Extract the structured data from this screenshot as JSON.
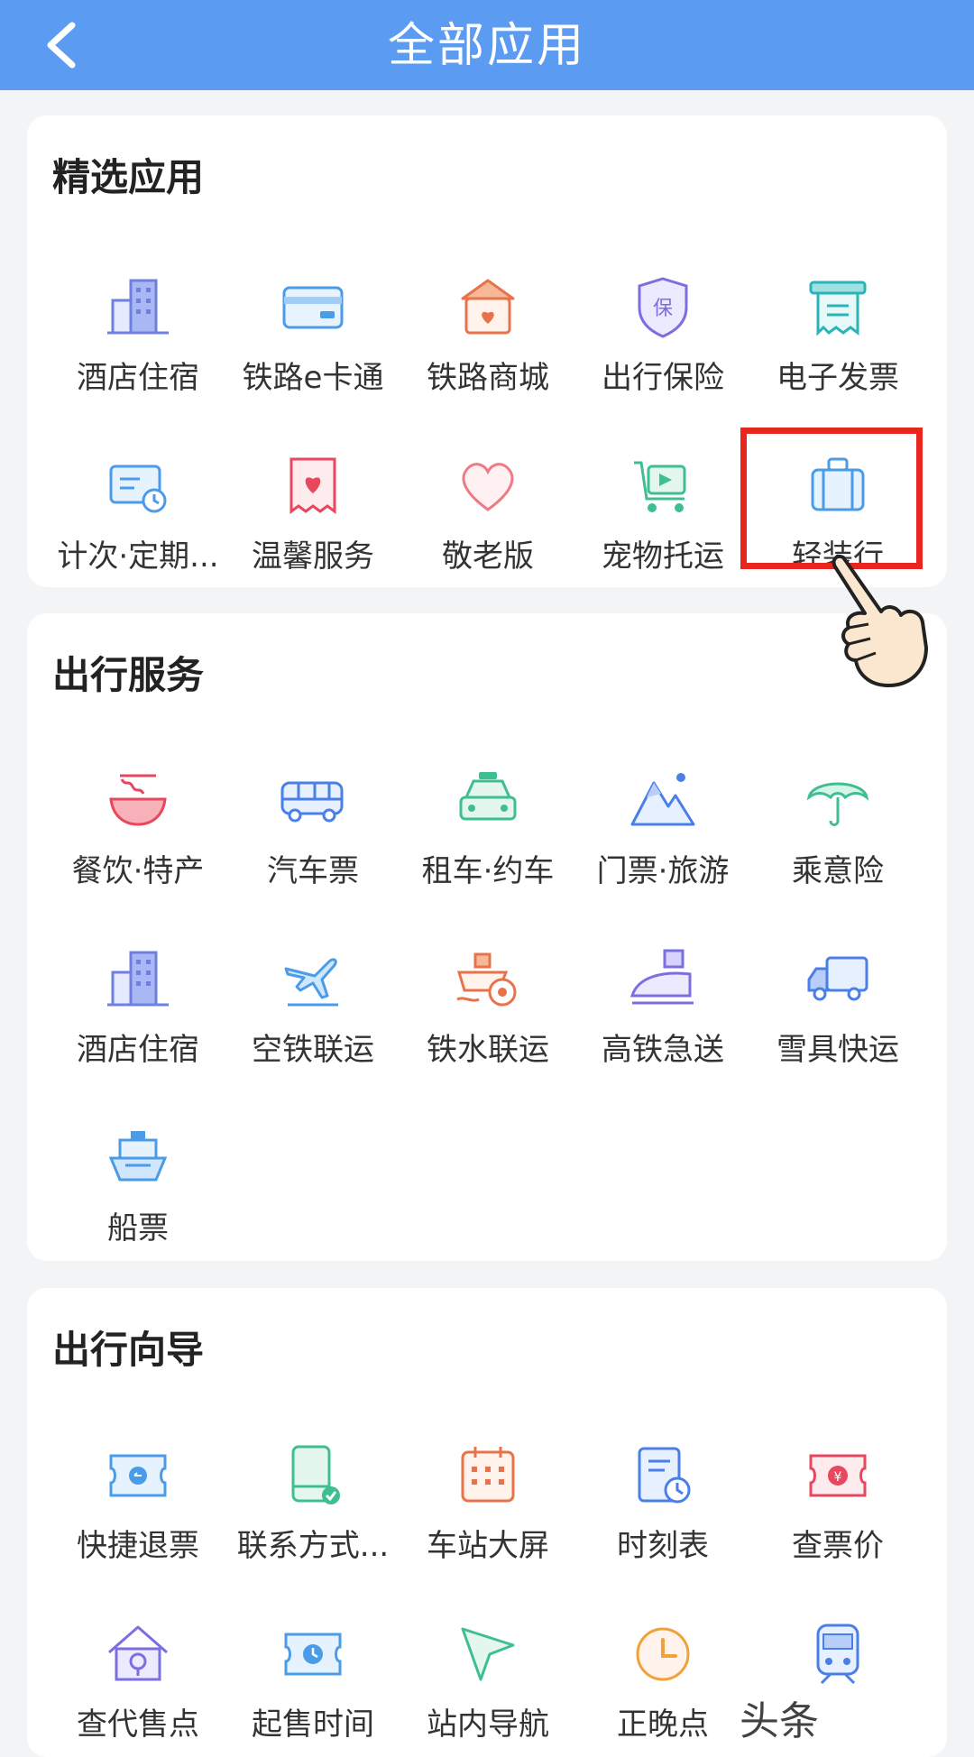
{
  "header": {
    "title": "全部应用"
  },
  "sections": [
    {
      "title": "精选应用",
      "items": [
        {
          "label": "酒店住宿",
          "icon": "hotel-building-icon"
        },
        {
          "label": "铁路e卡通",
          "icon": "card-icon"
        },
        {
          "label": "铁路商城",
          "icon": "shop-icon"
        },
        {
          "label": "出行保险",
          "icon": "insurance-shield-icon"
        },
        {
          "label": "电子发票",
          "icon": "invoice-icon"
        },
        {
          "label": "计次·定期...",
          "icon": "ticket-clock-icon"
        },
        {
          "label": "温馨服务",
          "icon": "heart-card-icon"
        },
        {
          "label": "敬老版",
          "icon": "heart-icon"
        },
        {
          "label": "宠物托运",
          "icon": "pet-cart-icon"
        },
        {
          "label": "轻装行",
          "icon": "luggage-icon"
        }
      ]
    },
    {
      "title": "出行服务",
      "items": [
        {
          "label": "餐饮·特产",
          "icon": "noodle-bowl-icon"
        },
        {
          "label": "汽车票",
          "icon": "bus-icon"
        },
        {
          "label": "租车·约车",
          "icon": "taxi-icon"
        },
        {
          "label": "门票·旅游",
          "icon": "mountain-icon"
        },
        {
          "label": "乘意险",
          "icon": "umbrella-icon"
        },
        {
          "label": "酒店住宿",
          "icon": "hotel-building-icon"
        },
        {
          "label": "空铁联运",
          "icon": "plane-train-icon"
        },
        {
          "label": "铁水联运",
          "icon": "ship-train-icon"
        },
        {
          "label": "高铁急送",
          "icon": "bullet-train-package-icon"
        },
        {
          "label": "雪具快运",
          "icon": "truck-icon"
        },
        {
          "label": "船票",
          "icon": "ship-icon"
        }
      ]
    },
    {
      "title": "出行向导",
      "items": [
        {
          "label": "快捷退票",
          "icon": "refund-ticket-icon"
        },
        {
          "label": "联系方式...",
          "icon": "phone-check-icon"
        },
        {
          "label": "车站大屏",
          "icon": "calendar-grid-icon"
        },
        {
          "label": "时刻表",
          "icon": "timetable-icon"
        },
        {
          "label": "查票价",
          "icon": "price-ticket-icon"
        },
        {
          "label": "查代售点",
          "icon": "house-icon"
        },
        {
          "label": "起售时间",
          "icon": "ticket-time-icon"
        },
        {
          "label": "站内导航",
          "icon": "navigation-arrow-icon"
        },
        {
          "label": "正晚点",
          "icon": "clock-icon"
        },
        {
          "label": "",
          "icon": "train-front-icon"
        }
      ]
    }
  ],
  "watermark": "头条"
}
